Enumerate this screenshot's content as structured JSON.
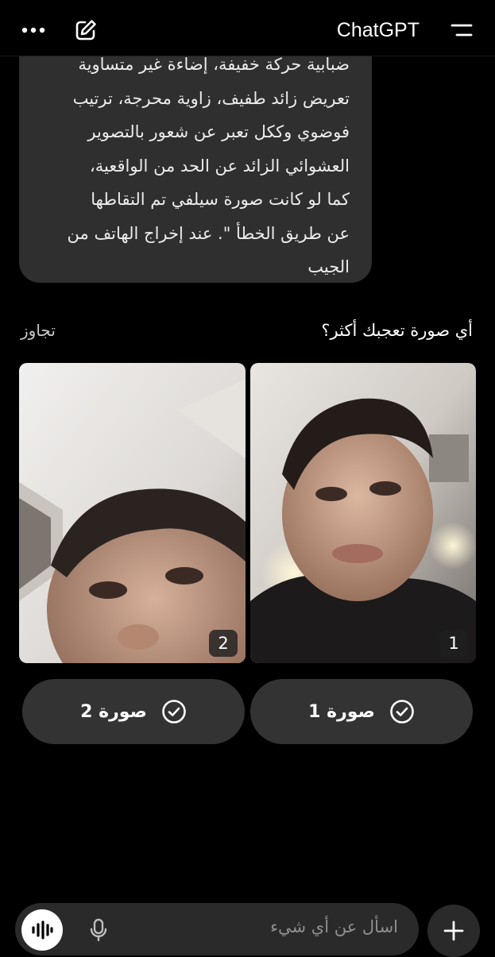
{
  "header": {
    "title": "ChatGPT",
    "icons": [
      "more-icon",
      "new-chat-icon",
      "menu-icon"
    ]
  },
  "message": {
    "lines": [
      "ضبابية حركة خفيفة، إضاءة غير متساوية",
      "تعريض زائد طفيف، زاوية محرجة، ترتيب",
      "فوضوي وككل تعبر عن شعور بالتصوير",
      "العشوائي الزائد عن الحد من الواقعية،",
      "كما لو كانت صورة سيلفي تم التقاطها",
      "عن طريق الخطأ \". عند إخراج الهاتف من",
      "الجيب"
    ]
  },
  "comparison": {
    "question": "أي صورة تعجبك أكثر؟",
    "skip_label": "تجاوز",
    "images": [
      {
        "number": "1",
        "choice_label": "صورة 1"
      },
      {
        "number": "2",
        "choice_label": "صورة 2"
      }
    ]
  },
  "composer": {
    "placeholder": "اسأل عن أي شيء",
    "icons": [
      "voice-mode-icon",
      "microphone-icon",
      "plus-icon"
    ]
  }
}
